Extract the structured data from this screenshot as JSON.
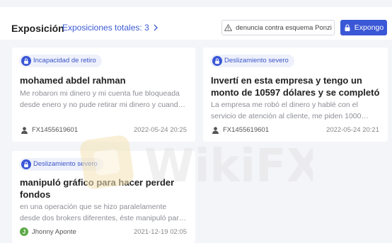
{
  "header": {
    "title": "Exposición",
    "total_label": "Exposiciones totales: 3",
    "report_button": "denuncia contra esquema Ponzi",
    "expose_button": "Expongo"
  },
  "cards": [
    {
      "badge": "Incapacidad de retiro",
      "title": "mohamed abdel rahman",
      "text": [
        "Me robaron mi dinero y mi cuenta fue bloqueada",
        "desde enero y no pude retirar mi dinero y cuand…"
      ],
      "author": "FX1455619601",
      "date": "2022-05-24 20:25"
    },
    {
      "badge": "Deslizamiento severo",
      "title": [
        "Invertí en esta empresa y tengo un",
        "monto de 10597 dólares y se completó"
      ],
      "text": [
        "La empresa me robó el dinero y hablé con el",
        "servicio de atención al cliente, me piden 1000…"
      ],
      "author": "FX1455619601",
      "date": "2022-05-24 20:21"
    },
    {
      "badge": "Deslizamiento severo",
      "title": [
        "manipuló gráfico para hacer perder",
        "fondos"
      ],
      "text": [
        "en una operación que se hizo paralelamente",
        "desde dos brokers diferentes, éste manipuló par…"
      ],
      "author": "Jhonny Aponte",
      "author_initial": "J",
      "date": "2021-12-19 02:05"
    }
  ],
  "watermark": {
    "text": "WikiFX"
  },
  "colors": {
    "accent": "#3a57d6",
    "badge_bg": "#eef1fb",
    "avatar_green": "#5aa845"
  }
}
